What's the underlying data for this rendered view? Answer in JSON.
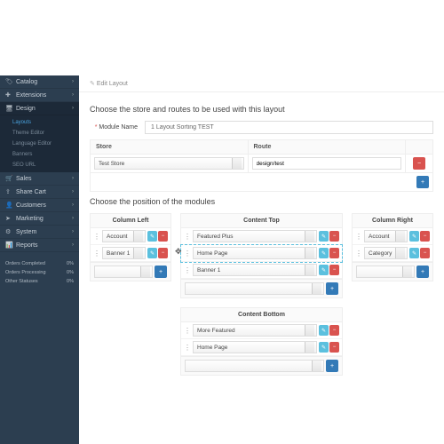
{
  "breadcrumb": {
    "edit": "Edit Layout"
  },
  "sidebar": {
    "items": [
      {
        "label": "Catalog"
      },
      {
        "label": "Extensions"
      },
      {
        "label": "Design"
      },
      {
        "label": "Sales"
      },
      {
        "label": "Share Cart"
      },
      {
        "label": "Customers"
      },
      {
        "label": "Marketing"
      },
      {
        "label": "System"
      },
      {
        "label": "Reports"
      }
    ],
    "sub": [
      {
        "label": "Layouts"
      },
      {
        "label": "Theme Editor"
      },
      {
        "label": "Language Editor"
      },
      {
        "label": "Banners"
      },
      {
        "label": "SEO URL"
      }
    ],
    "stats": [
      {
        "label": "Orders Completed",
        "val": "0%"
      },
      {
        "label": "Orders Processing",
        "val": "0%"
      },
      {
        "label": "Other Statuses",
        "val": "0%"
      }
    ]
  },
  "sections": {
    "s1": "Choose the store and routes to be used with this layout",
    "s2": "Choose the position of the modules"
  },
  "form": {
    "moduleNameLabel": "Module Name",
    "moduleName": "1 Layout Sorting TEST",
    "storeHeader": "Store",
    "routeHeader": "Route",
    "store": "Test Store",
    "route": "design/test"
  },
  "cols": {
    "left": {
      "title": "Column Left",
      "rows": [
        {
          "v": "Account"
        },
        {
          "v": "Banner 1"
        }
      ]
    },
    "top": {
      "title": "Content Top",
      "rows": [
        {
          "v": "Featured Plus"
        },
        {
          "v": "Home Page",
          "hl": true
        },
        {
          "v": "Banner 1"
        }
      ]
    },
    "bottom": {
      "title": "Content Bottom",
      "rows": [
        {
          "v": "More Featured"
        },
        {
          "v": "Home Page"
        }
      ]
    },
    "right": {
      "title": "Column Right",
      "rows": [
        {
          "v": "Account"
        },
        {
          "v": "Category"
        }
      ]
    }
  },
  "icons": {
    "plus": "+",
    "minus": "−",
    "pencil": "✎",
    "cog": "⚙"
  }
}
